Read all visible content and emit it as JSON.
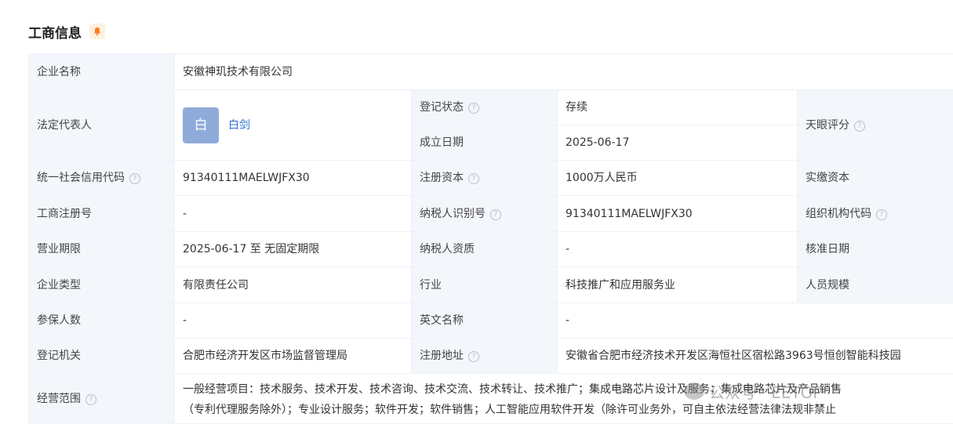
{
  "section": {
    "title": "工商信息"
  },
  "rows": {
    "company_name": {
      "label": "企业名称",
      "value": "安徽神玑技术有限公司"
    },
    "legal_rep": {
      "label": "法定代表人",
      "avatar_char": "白",
      "name": "白剑"
    },
    "reg_status": {
      "label": "登记状态",
      "value": "存续"
    },
    "founded": {
      "label": "成立日期",
      "value": "2025-06-17"
    },
    "tianyan_score": {
      "label": "天眼评分"
    },
    "credit_code": {
      "label": "统一社会信用代码",
      "value": "91340111MAELWJFX30"
    },
    "reg_capital": {
      "label": "注册资本",
      "value": "1000万人民币"
    },
    "paid_capital": {
      "label": "实缴资本"
    },
    "biz_reg_no": {
      "label": "工商注册号",
      "value": "-"
    },
    "taxpayer_id": {
      "label": "纳税人识别号",
      "value": "91340111MAELWJFX30"
    },
    "org_code": {
      "label": "组织机构代码"
    },
    "biz_term": {
      "label": "营业期限",
      "value": "2025-06-17 至 无固定期限"
    },
    "taxpayer_qual": {
      "label": "纳税人资质",
      "value": "-"
    },
    "approval_date": {
      "label": "核准日期"
    },
    "company_type": {
      "label": "企业类型",
      "value": "有限责任公司"
    },
    "industry": {
      "label": "行业",
      "value": "科技推广和应用服务业"
    },
    "staff_size": {
      "label": "人员规模"
    },
    "insured": {
      "label": "参保人数",
      "value": "-"
    },
    "english_name": {
      "label": "英文名称",
      "value": "-"
    },
    "reg_authority": {
      "label": "登记机关",
      "value": "合肥市经济开发区市场监督管理局"
    },
    "reg_address": {
      "label": "注册地址",
      "value": "安徽省合肥市经济技术开发区海恒社区宿松路3963号恒创智能科技园"
    },
    "biz_scope": {
      "label": "经营范围",
      "line1": "一般经营项目：技术服务、技术开发、技术咨询、技术交流、技术转让、技术推广；集成电路芯片设计及服务；集成电路芯片及产品销售",
      "line2": "（专利代理服务除外）；专业设计服务；软件开发；软件销售；人工智能应用软件开发（除许可业务外，可自主依法经营法律法规非禁止"
    }
  },
  "watermark": {
    "text": "公众号 · EETOP"
  },
  "colors": {
    "label_bg": "#f3f6fb",
    "status_green": "#2ea650",
    "link_blue": "#2f6fd6",
    "avatar_bg": "#8fabd9",
    "bell_orange": "#ff7a1a"
  },
  "icons": {
    "title_badge": "bell-icon",
    "help": "question-circle-icon"
  }
}
